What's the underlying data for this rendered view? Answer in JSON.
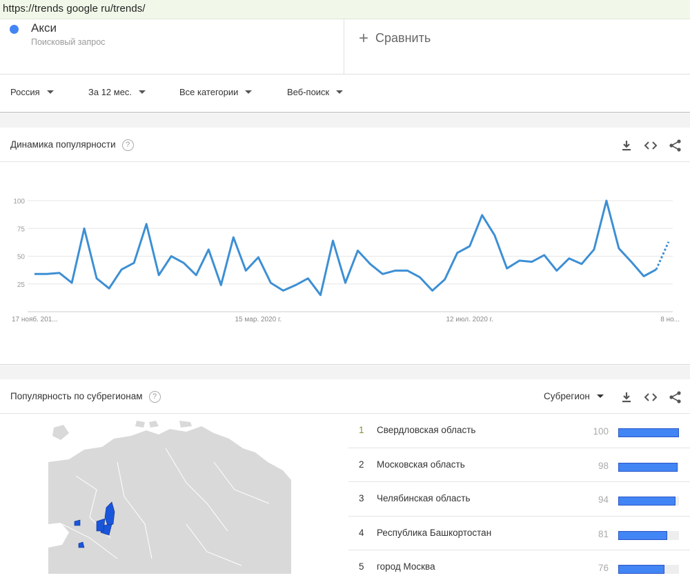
{
  "browser": {
    "url": "https://trends google ru/trends/"
  },
  "term": {
    "name": "Акси",
    "type": "Поисковый запрос",
    "color": "#4285f4"
  },
  "compare": {
    "label": "Сравнить",
    "icon": "plus-icon"
  },
  "filters": [
    {
      "label": "Россия"
    },
    {
      "label": "За 12 мес."
    },
    {
      "label": "Все категории"
    },
    {
      "label": "Веб-поиск"
    }
  ],
  "interest_over_time": {
    "title": "Динамика популярности",
    "help_icon": "help-icon",
    "tools": [
      "download-icon",
      "embed-icon",
      "share-icon"
    ]
  },
  "chart_data": {
    "type": "line",
    "title": "",
    "xlabel": "",
    "ylabel": "",
    "ylim": [
      0,
      100
    ],
    "yticks": [
      25,
      50,
      75,
      100
    ],
    "grid": true,
    "xtick_labels": [
      {
        "index": 0,
        "label": "17 нояб. 201..."
      },
      {
        "index": 17,
        "label": "15 мар. 2020 г."
      },
      {
        "index": 34,
        "label": "12 июл. 2020 г."
      },
      {
        "index": 51,
        "label": "8 но..."
      }
    ],
    "partial_from_index": 50,
    "series": [
      {
        "color": "#3d8fd4",
        "values": [
          34,
          34,
          35,
          26,
          75,
          30,
          21,
          38,
          44,
          79,
          33,
          50,
          44,
          33,
          56,
          24,
          67,
          37,
          49,
          26,
          19,
          24,
          30,
          15,
          64,
          26,
          55,
          43,
          34,
          37,
          37,
          31,
          19,
          29,
          53,
          59,
          87,
          69,
          39,
          46,
          45,
          51,
          37,
          48,
          43,
          56,
          100,
          57,
          45,
          32,
          38,
          63
        ]
      }
    ]
  },
  "subregions": {
    "title": "Популярность по субрегионам",
    "help_icon": "help-icon",
    "selector_label": "Субрегион",
    "tools": [
      "download-icon",
      "embed-icon",
      "share-icon"
    ],
    "map_highlight_color": "#1a56db",
    "map_base_color": "#d9d9d9",
    "rows": [
      {
        "rank": "1",
        "name": "Свердловская область",
        "value": 100
      },
      {
        "rank": "2",
        "name": "Московская область",
        "value": 98
      },
      {
        "rank": "3",
        "name": "Челябинская область",
        "value": 94
      },
      {
        "rank": "4",
        "name": "Республика Башкортостан",
        "value": 81
      },
      {
        "rank": "5",
        "name": "город Москва",
        "value": 76
      }
    ]
  }
}
